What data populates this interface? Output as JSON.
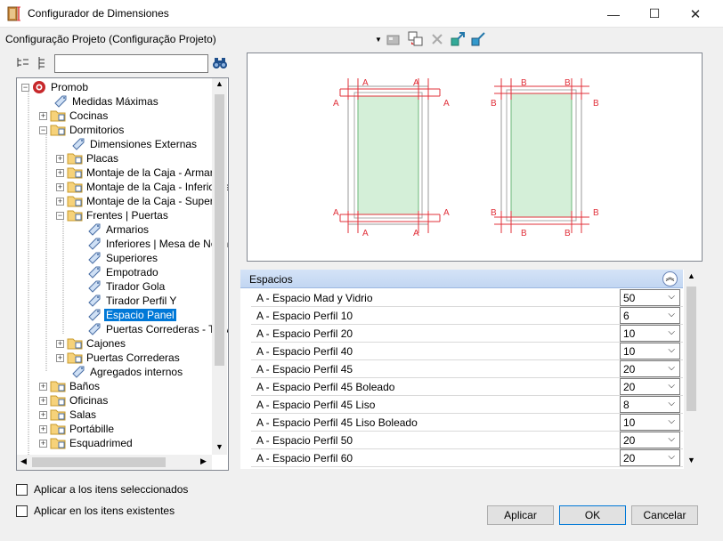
{
  "window": {
    "title": "Configurador de Dimensiones",
    "minimize": "—",
    "maximize": "☐",
    "close": "✕"
  },
  "config": {
    "label": "Configuração Projeto (Configuração Projeto)"
  },
  "tree": {
    "items": [
      {
        "label": "Promob"
      },
      {
        "label": "Medidas Máximas"
      },
      {
        "label": "Cocinas"
      },
      {
        "label": "Dormitorios"
      },
      {
        "label": "Dimensiones Externas"
      },
      {
        "label": "Placas"
      },
      {
        "label": "Montaje de la Caja - Armarios"
      },
      {
        "label": "Montaje de la Caja - Inferiores"
      },
      {
        "label": "Montaje de la Caja - Superior"
      },
      {
        "label": "Frentes | Puertas"
      },
      {
        "label": "Armarios"
      },
      {
        "label": "Inferiores | Mesa de Noch"
      },
      {
        "label": "Superiores"
      },
      {
        "label": "Empotrado"
      },
      {
        "label": "Tirador Gola"
      },
      {
        "label": "Tirador Perfil Y"
      },
      {
        "label": "Espacio Panel"
      },
      {
        "label": "Puertas Correderas - Trav"
      },
      {
        "label": "Cajones"
      },
      {
        "label": "Puertas Correderas"
      },
      {
        "label": "Agregados internos"
      },
      {
        "label": "Baños"
      },
      {
        "label": "Oficinas"
      },
      {
        "label": "Salas"
      },
      {
        "label": "Portábille"
      },
      {
        "label": "Esquadrimed"
      }
    ]
  },
  "checkboxes": {
    "selected": "Aplicar a los itens seleccionados",
    "existing": "Aplicar en los itens existentes"
  },
  "diagram": {
    "label_a": "A",
    "label_b": "B"
  },
  "props": {
    "section": "Espacios",
    "rows": [
      {
        "name": "A - Espacio Mad y Vidrio",
        "value": "50"
      },
      {
        "name": "A - Espacio Perfil 10",
        "value": "6"
      },
      {
        "name": "A - Espacio Perfil 20",
        "value": "10"
      },
      {
        "name": "A - Espacio Perfil 40",
        "value": "10"
      },
      {
        "name": "A - Espacio Perfil 45",
        "value": "20"
      },
      {
        "name": "A - Espacio Perfil 45 Boleado",
        "value": "20"
      },
      {
        "name": "A - Espacio Perfil 45 Liso",
        "value": "8"
      },
      {
        "name": "A - Espacio Perfil 45 Liso Boleado",
        "value": "10"
      },
      {
        "name": "A - Espacio Perfil 50",
        "value": "20"
      },
      {
        "name": "A - Espacio Perfil 60",
        "value": "20"
      }
    ]
  },
  "buttons": {
    "apply": "Aplicar",
    "ok": "OK",
    "cancel": "Cancelar"
  },
  "colors": {
    "accent": "#0078d7",
    "dim_red": "#e0303a",
    "panel_green": "#d4efd8"
  }
}
